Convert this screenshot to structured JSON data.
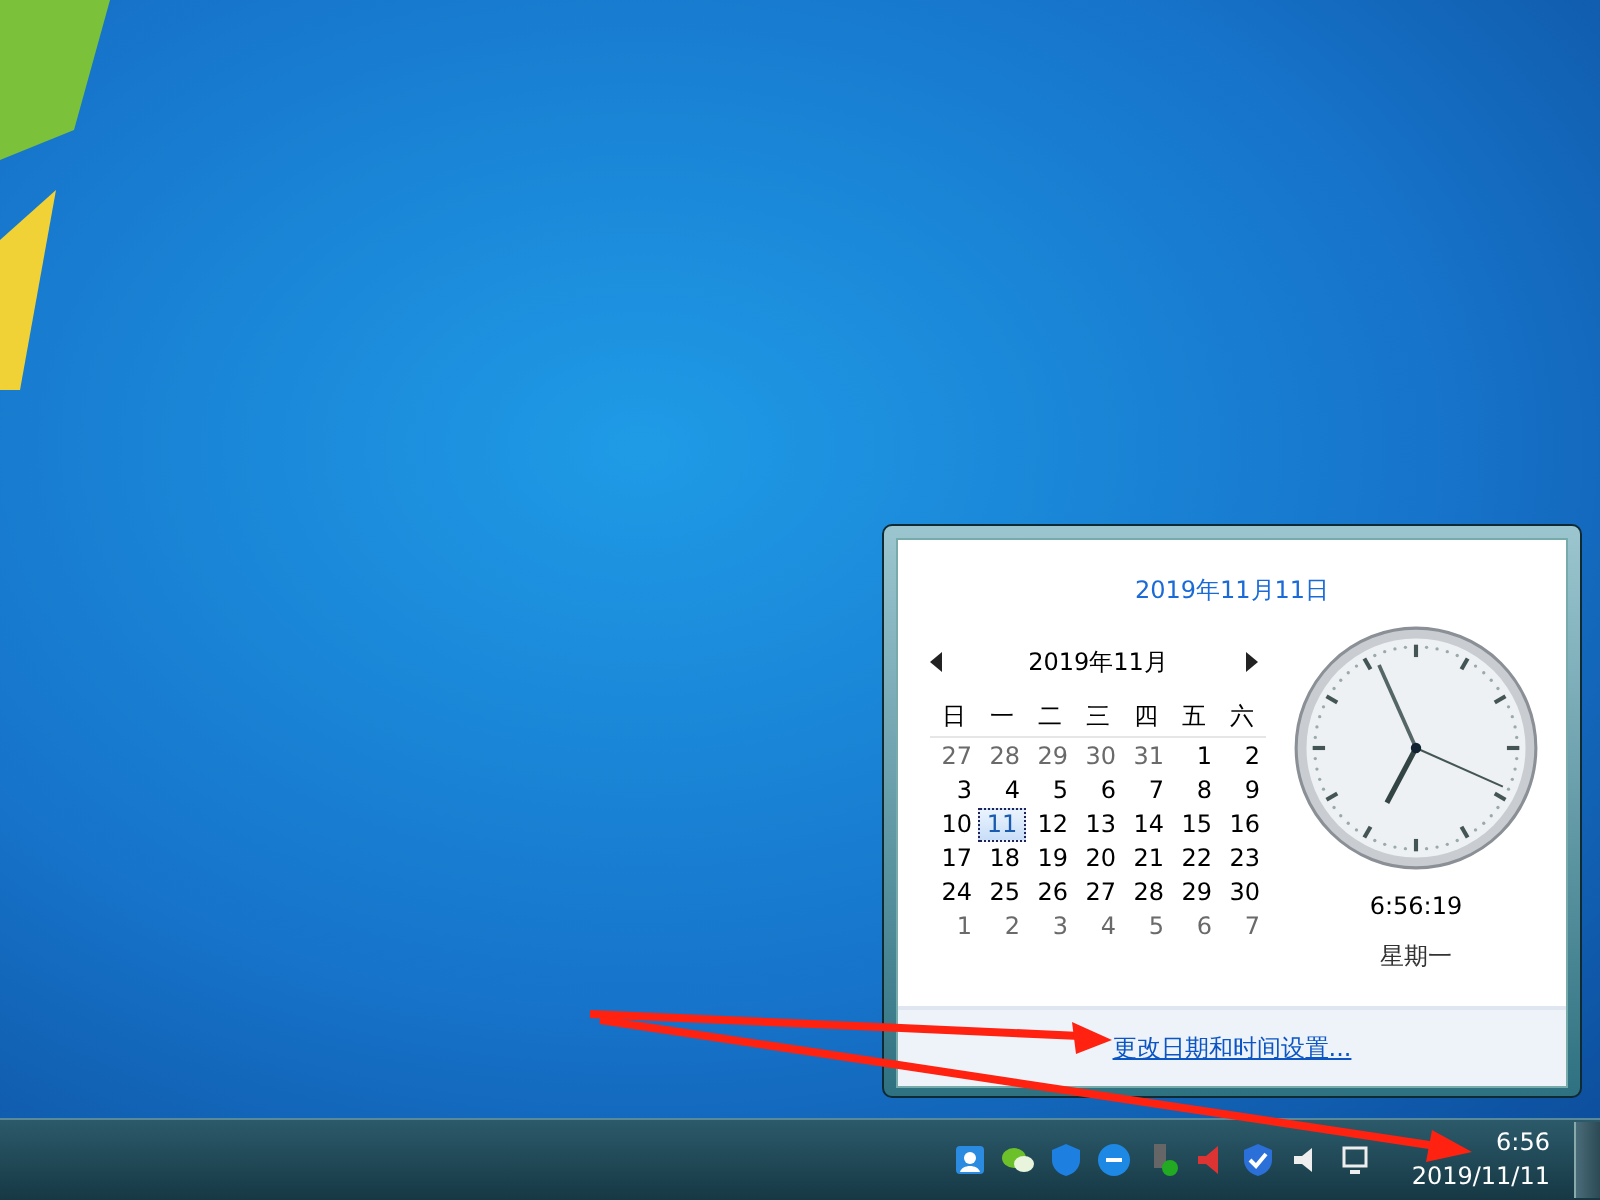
{
  "popup": {
    "full_date": "2019年11月11日",
    "month_title": "2019年11月",
    "weekdays": [
      "日",
      "一",
      "二",
      "三",
      "四",
      "五",
      "六"
    ],
    "weeks": [
      [
        {
          "day": "27",
          "kind": "other",
          "selected": false
        },
        {
          "day": "28",
          "kind": "other",
          "selected": false
        },
        {
          "day": "29",
          "kind": "other",
          "selected": false
        },
        {
          "day": "30",
          "kind": "other",
          "selected": false
        },
        {
          "day": "31",
          "kind": "other",
          "selected": false
        },
        {
          "day": "1",
          "kind": "current",
          "selected": false
        },
        {
          "day": "2",
          "kind": "current",
          "selected": false
        }
      ],
      [
        {
          "day": "3",
          "kind": "current",
          "selected": false
        },
        {
          "day": "4",
          "kind": "current",
          "selected": false
        },
        {
          "day": "5",
          "kind": "current",
          "selected": false
        },
        {
          "day": "6",
          "kind": "current",
          "selected": false
        },
        {
          "day": "7",
          "kind": "current",
          "selected": false
        },
        {
          "day": "8",
          "kind": "current",
          "selected": false
        },
        {
          "day": "9",
          "kind": "current",
          "selected": false
        }
      ],
      [
        {
          "day": "10",
          "kind": "current",
          "selected": false
        },
        {
          "day": "11",
          "kind": "current",
          "selected": true
        },
        {
          "day": "12",
          "kind": "current",
          "selected": false
        },
        {
          "day": "13",
          "kind": "current",
          "selected": false
        },
        {
          "day": "14",
          "kind": "current",
          "selected": false
        },
        {
          "day": "15",
          "kind": "current",
          "selected": false
        },
        {
          "day": "16",
          "kind": "current",
          "selected": false
        }
      ],
      [
        {
          "day": "17",
          "kind": "current",
          "selected": false
        },
        {
          "day": "18",
          "kind": "current",
          "selected": false
        },
        {
          "day": "19",
          "kind": "current",
          "selected": false
        },
        {
          "day": "20",
          "kind": "current",
          "selected": false
        },
        {
          "day": "21",
          "kind": "current",
          "selected": false
        },
        {
          "day": "22",
          "kind": "current",
          "selected": false
        },
        {
          "day": "23",
          "kind": "current",
          "selected": false
        }
      ],
      [
        {
          "day": "24",
          "kind": "current",
          "selected": false
        },
        {
          "day": "25",
          "kind": "current",
          "selected": false
        },
        {
          "day": "26",
          "kind": "current",
          "selected": false
        },
        {
          "day": "27",
          "kind": "current",
          "selected": false
        },
        {
          "day": "28",
          "kind": "current",
          "selected": false
        },
        {
          "day": "29",
          "kind": "current",
          "selected": false
        },
        {
          "day": "30",
          "kind": "current",
          "selected": false
        }
      ],
      [
        {
          "day": "1",
          "kind": "other",
          "selected": false
        },
        {
          "day": "2",
          "kind": "other",
          "selected": false
        },
        {
          "day": "3",
          "kind": "other",
          "selected": false
        },
        {
          "day": "4",
          "kind": "other",
          "selected": false
        },
        {
          "day": "5",
          "kind": "other",
          "selected": false
        },
        {
          "day": "6",
          "kind": "other",
          "selected": false
        },
        {
          "day": "7",
          "kind": "other",
          "selected": false
        }
      ]
    ],
    "time": "6:56:19",
    "weekday": "星期一",
    "settings_link": "更改日期和时间设置..."
  },
  "taskbar": {
    "time": "6:56",
    "date": "2019/11/11"
  }
}
